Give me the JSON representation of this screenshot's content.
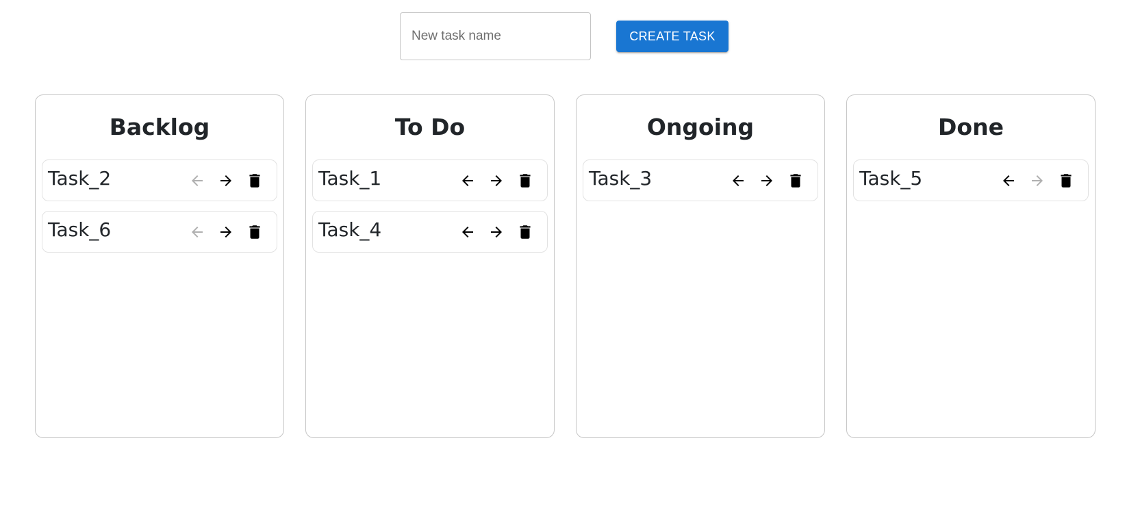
{
  "new_task": {
    "placeholder": "New task name",
    "value": ""
  },
  "create_button_label": "CREATE TASK",
  "colors": {
    "accent": "#1976d2",
    "enabled_icon": "#000000",
    "disabled_icon": "#b0b0b0"
  },
  "columns": [
    {
      "title": "Backlog",
      "tasks": [
        {
          "name": "Task_2",
          "left_enabled": false,
          "right_enabled": true
        },
        {
          "name": "Task_6",
          "left_enabled": false,
          "right_enabled": true
        }
      ]
    },
    {
      "title": "To Do",
      "tasks": [
        {
          "name": "Task_1",
          "left_enabled": true,
          "right_enabled": true
        },
        {
          "name": "Task_4",
          "left_enabled": true,
          "right_enabled": true
        }
      ]
    },
    {
      "title": "Ongoing",
      "tasks": [
        {
          "name": "Task_3",
          "left_enabled": true,
          "right_enabled": true
        }
      ]
    },
    {
      "title": "Done",
      "tasks": [
        {
          "name": "Task_5",
          "left_enabled": true,
          "right_enabled": false
        }
      ]
    }
  ]
}
